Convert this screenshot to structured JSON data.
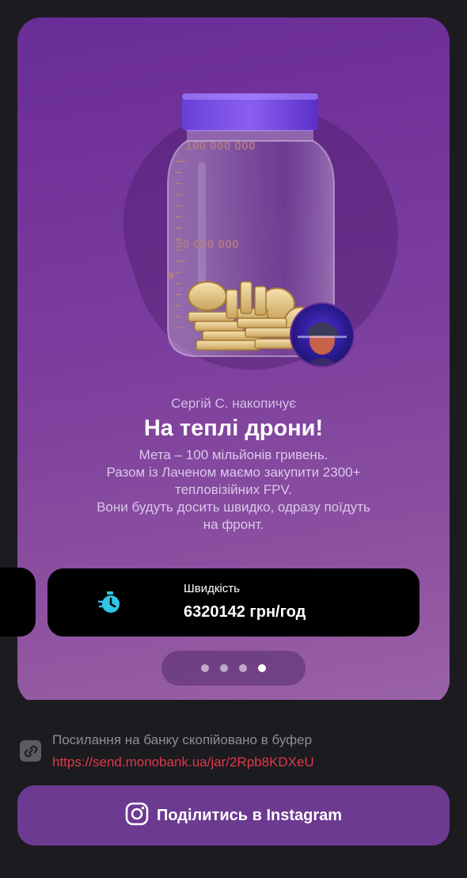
{
  "jar": {
    "scale_top": "100 000 000",
    "scale_mid": "50 000 000"
  },
  "goal": {
    "owner_text": "Сергій С. накопичує",
    "title": "На теплі дрони!",
    "description": "Мета – 100 мільйонів гривень.\nРазом із Лаченом маємо закупити 2300+\nтепловізійних FPV.\nВони будуть досить швидко, одразу поїдуть\nна фронт."
  },
  "speed": {
    "label": "Швидкість",
    "value": "6320142 грн/год",
    "icon": "stopwatch-icon"
  },
  "pagination": {
    "count": 4,
    "active_index": 3
  },
  "clipboard": {
    "message": "Посилання на банку скопійовано в буфер",
    "link": "https://send.monobank.ua/jar/2Rpb8KDXeU",
    "icon": "link-icon"
  },
  "share": {
    "label": "Поділитись в Instagram",
    "icon": "instagram-icon"
  },
  "colors": {
    "card_top": "#6a2c97",
    "card_bottom": "#9a62a6",
    "link_red": "#e0384a",
    "accent_cyan": "#2fc6e6",
    "button_purple": "#6d3a92"
  }
}
